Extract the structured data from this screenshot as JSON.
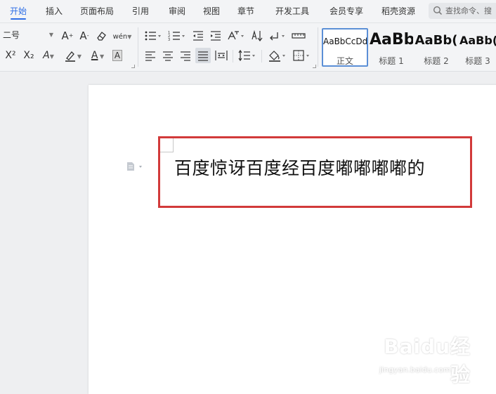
{
  "tabs": [
    {
      "label": "开始",
      "active": true
    },
    {
      "label": "插入"
    },
    {
      "label": "页面布局"
    },
    {
      "label": "引用"
    },
    {
      "label": "审阅"
    },
    {
      "label": "视图"
    },
    {
      "label": "章节"
    },
    {
      "label": "开发工具"
    },
    {
      "label": "会员专享"
    },
    {
      "label": "稻壳资源"
    }
  ],
  "search": {
    "placeholder": "查找命令、搜"
  },
  "ribbon": {
    "font_size": "二号",
    "glyphs": {
      "grow_font": "A",
      "shrink_font": "A",
      "pinyin_char": "wén",
      "superscript": "X²",
      "subscript": "X₂",
      "text_effect": "A",
      "font_color": "A",
      "char_shade": "A"
    },
    "styles": [
      {
        "sample": "AaBbCcDd",
        "label": "正文",
        "selected": true
      },
      {
        "sample": "AaBb",
        "label": "标题 1"
      },
      {
        "sample": "AaBb(",
        "label": "标题 2"
      },
      {
        "sample": "AaBb(",
        "label": "标题 3"
      }
    ]
  },
  "document": {
    "text": "百度惊讶百度经百度嘟嘟嘟嘟的"
  },
  "watermark": {
    "brand": "Baidu经验",
    "url": "jingyan.baidu.com"
  },
  "colors": {
    "accent": "#2e6ee6",
    "highlight": "#d23a3a"
  }
}
